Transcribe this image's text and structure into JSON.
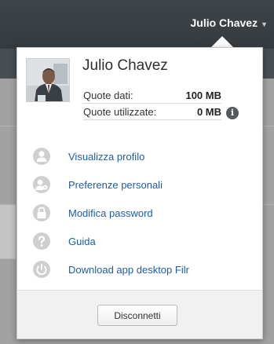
{
  "header": {
    "user_menu_label": "Julio Chavez"
  },
  "profile": {
    "name": "Julio Chavez",
    "quota": [
      {
        "label": "Quote dati:",
        "value": "100 MB"
      },
      {
        "label": "Quote utilizzate:",
        "value": "0 MB"
      }
    ]
  },
  "menu": {
    "items": [
      {
        "label": "Visualizza profilo",
        "icon": "user-icon"
      },
      {
        "label": "Preferenze personali",
        "icon": "user-settings-icon"
      },
      {
        "label": "Modifica password",
        "icon": "lock-icon"
      },
      {
        "label": "Guida",
        "icon": "help-icon"
      },
      {
        "label": "Download app desktop Filr",
        "icon": "power-icon"
      }
    ]
  },
  "footer": {
    "logout_label": "Disconnetti"
  },
  "colors": {
    "link": "#1f5ca8",
    "icon_gray": "#cfcfcf",
    "topbar": "#3a4044"
  }
}
